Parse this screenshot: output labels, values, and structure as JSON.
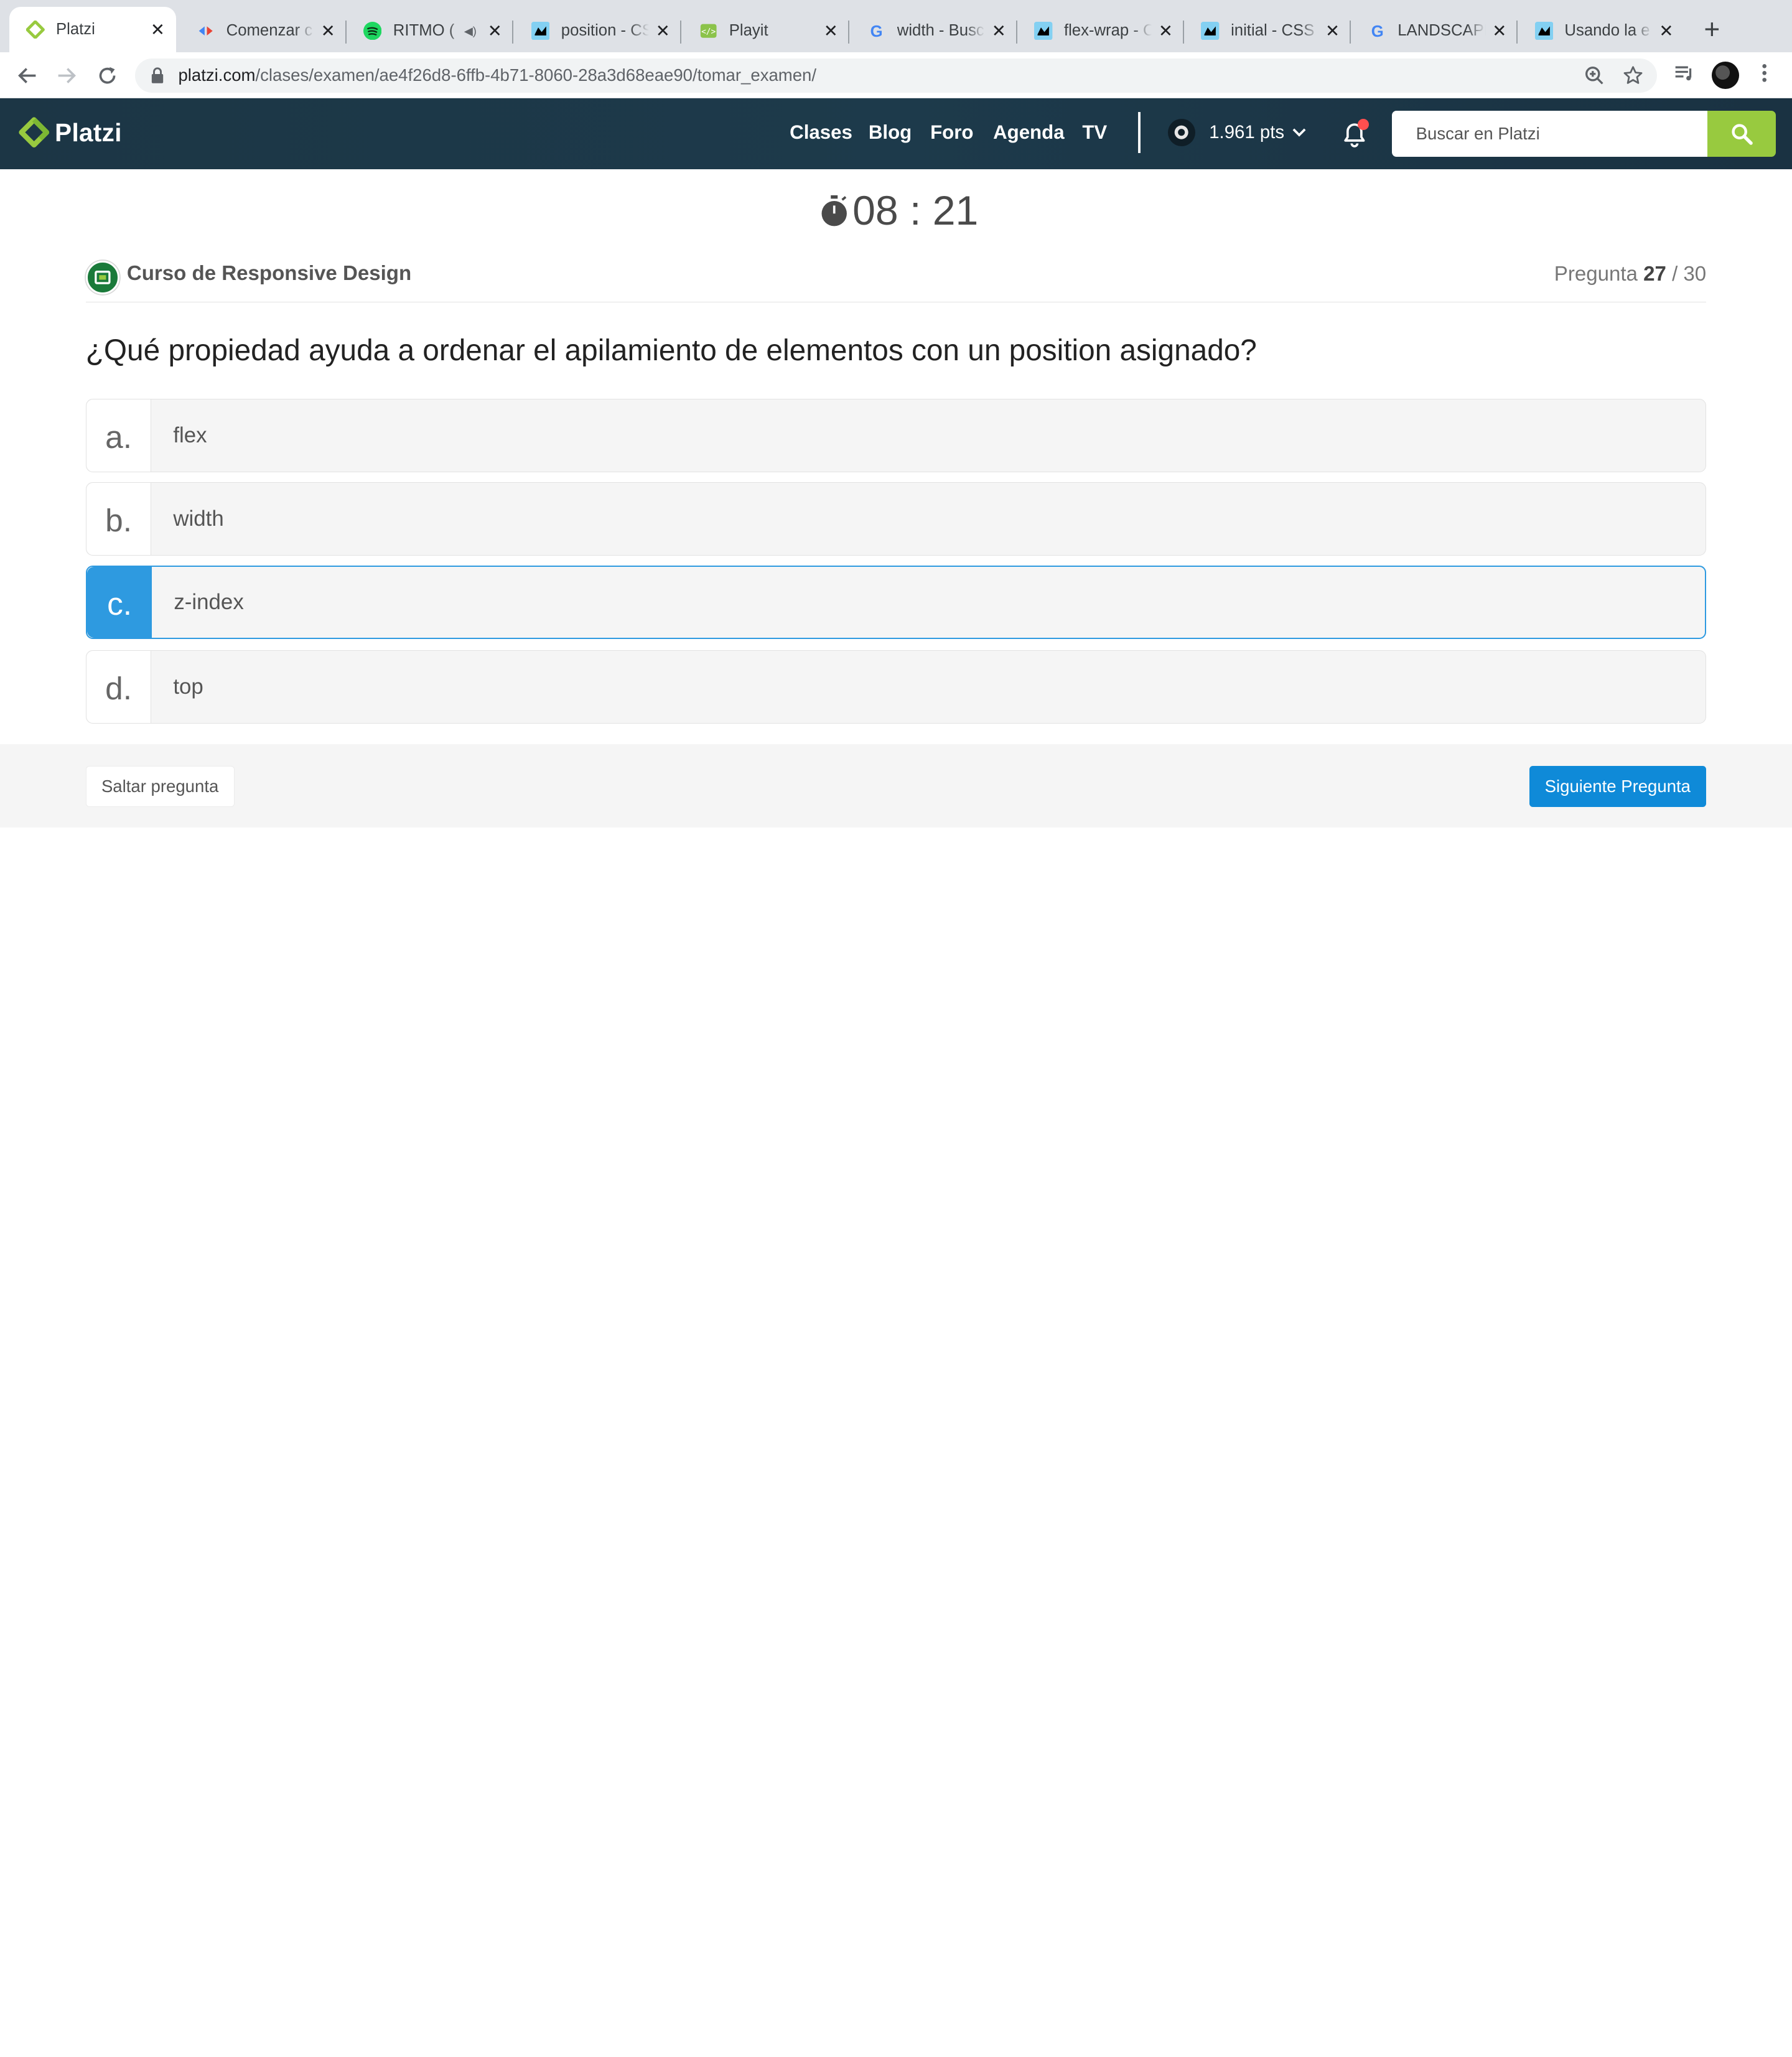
{
  "browser": {
    "tabs": [
      {
        "title": "Platzi",
        "icon": "platzi-icon",
        "active": true
      },
      {
        "title": "Comenzar c",
        "icon": "google-icon"
      },
      {
        "title": "RITMO (",
        "icon": "spotify-icon",
        "muted": true
      },
      {
        "title": "position - CS",
        "icon": "mdn-icon"
      },
      {
        "title": "Playit",
        "icon": "playit-icon"
      },
      {
        "title": "width - Busc",
        "icon": "google-icon"
      },
      {
        "title": "flex-wrap - C",
        "icon": "mdn-icon"
      },
      {
        "title": "initial - CSS",
        "icon": "mdn-icon"
      },
      {
        "title": "LANDSCAPE",
        "icon": "google-icon"
      },
      {
        "title": "Usando la e",
        "icon": "mdn-icon"
      }
    ],
    "url_host": "platzi.com",
    "url_path": "/clases/examen/ae4f26d8-6ffb-4b71-8060-28a3d68eae90/tomar_examen/"
  },
  "header": {
    "brand": "Platzi",
    "nav": [
      "Clases",
      "Blog",
      "Foro",
      "Agenda",
      "TV"
    ],
    "points": "1.961 pts",
    "search_placeholder": "Buscar en Platzi",
    "brand_color": "#98ca3f"
  },
  "exam": {
    "timer": "08 : 21",
    "course": "Curso de Responsive Design",
    "counter_label": "Pregunta",
    "counter_current": "27",
    "counter_total": "/ 30",
    "question": "¿Qué propiedad ayuda a ordenar el apilamiento de elementos con un position asignado?",
    "options": [
      {
        "letter": "a.",
        "text": "flex"
      },
      {
        "letter": "b.",
        "text": "width"
      },
      {
        "letter": "c.",
        "text": "z-index",
        "selected": true
      },
      {
        "letter": "d.",
        "text": "top"
      }
    ],
    "selected_color": "#2e9ae0",
    "skip_label": "Saltar pregunta",
    "next_label": "Siguiente Pregunta"
  }
}
